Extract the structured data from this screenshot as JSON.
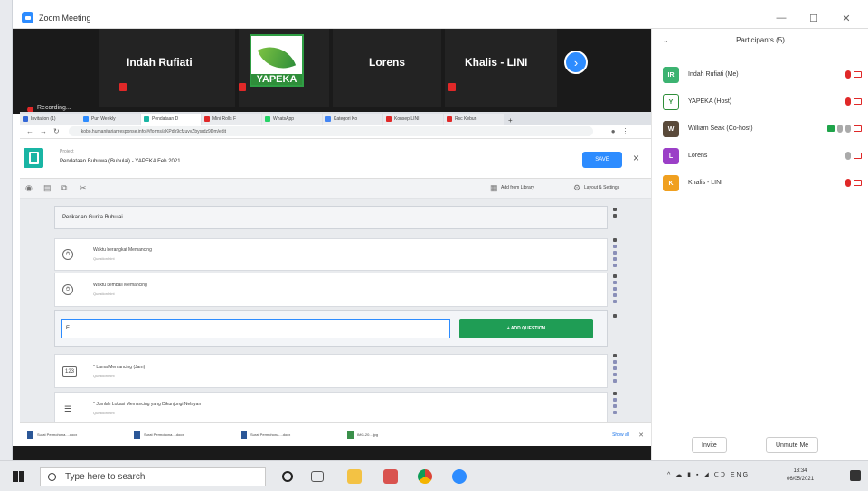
{
  "zoom": {
    "window_title": "Zoom Meeting",
    "minimize": "—",
    "maximize": "☐",
    "close": "✕"
  },
  "gallery": {
    "participants": [
      {
        "name": "Indah Rufiati"
      },
      {
        "name": "YAPEKA"
      },
      {
        "name": "Lorens"
      },
      {
        "name": "Khalis - LINI"
      }
    ],
    "logo_text": "YAPEKA",
    "recording": "Recording..."
  },
  "browser": {
    "tabs": [
      {
        "label": "Invitation (1)",
        "color": "#3367d6"
      },
      {
        "label": "Pun Weekly",
        "color": "#2D8CFF"
      },
      {
        "label": "Pendataan D",
        "color": "#19b5a4",
        "active": true
      },
      {
        "label": "Mini Rolls F",
        "color": "#e02828"
      },
      {
        "label": "WhatsApp",
        "color": "#25d366"
      },
      {
        "label": "Kategori Ko",
        "color": "#4285f4"
      },
      {
        "label": "Konsep LINI",
        "color": "#e02828"
      },
      {
        "label": "Rsc Kebun",
        "color": "#e02828"
      }
    ],
    "url": "kobo.humanitarianresponse.info/#/forms/aKPdh9cfzuvvZbysrdz9Dm/edit"
  },
  "app": {
    "project_label": "Project",
    "project_title": "Pendataan Bubuwa (Bubulai) - YAPEKA Feb 2021",
    "save_label": "SAVE",
    "toolbar": {
      "library_label": "Add from Library",
      "layout_label": "Layout & Settings"
    },
    "section_title": "Perikanan Gurita Bubulai",
    "questions": [
      {
        "icon": "clock-icon",
        "glyph": "⏱",
        "title": "Waktu berangkat Memancing",
        "hint": "Question hint"
      },
      {
        "icon": "clock-icon",
        "glyph": "⏱",
        "title": "Waktu kembali Memancing",
        "hint": "Question hint"
      },
      {
        "icon": "number-icon",
        "glyph": "123",
        "title": "* Lama Memancing (Jam)",
        "hint": "Question hint"
      },
      {
        "icon": "list-icon",
        "glyph": "☰",
        "title": "* Jumlah Lokasi Memancing yang Dikunjungi Nelayan",
        "hint": "Question hint"
      }
    ],
    "add_input_value": "E",
    "add_question_label": "+ ADD QUESTION"
  },
  "downloads": {
    "items": [
      {
        "label": "Surat Permohona....docx"
      },
      {
        "label": "Surat Permohona....docx"
      },
      {
        "label": "Surat Permohona....docx"
      },
      {
        "label": "IMG-20....jpg"
      }
    ],
    "show_all": "Show all"
  },
  "participants_panel": {
    "header": "Participants (5)",
    "rows": [
      {
        "initials": "IR",
        "name": "Indah Rufiati (Me)",
        "color": "#3cb371",
        "mic": "muted",
        "cam": "off"
      },
      {
        "initials": "Y",
        "name": "YAPEKA (Host)",
        "color": "#ffffff",
        "mic": "muted",
        "cam": "off"
      },
      {
        "initials": "W",
        "name": "William Seak (Co-host)",
        "color": "#5a4a3a",
        "mic": "on",
        "cam": "off",
        "share": true
      },
      {
        "initials": "L",
        "name": "Lorens",
        "color": "#9b3fc7",
        "mic": "on",
        "cam": "off"
      },
      {
        "initials": "K",
        "name": "Khalis - LINI",
        "color": "#f0a020",
        "mic": "muted",
        "cam": "off"
      }
    ],
    "invite": "Invite",
    "unmute_me": "Unmute Me"
  },
  "taskbar": {
    "search_placeholder": "Type here to search",
    "tray": "^ ☁ ▮ ▪ ◢ ᑕᑐ ENG",
    "time": "13:34",
    "date": "06/05/2021"
  }
}
